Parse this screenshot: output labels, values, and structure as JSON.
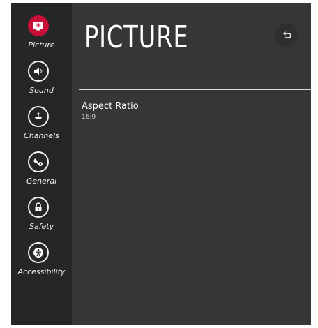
{
  "sidebar": {
    "items": [
      {
        "label": "Picture",
        "icon": "picture-icon",
        "active": true
      },
      {
        "label": "Sound",
        "icon": "sound-icon"
      },
      {
        "label": "Channels",
        "icon": "channels-icon"
      },
      {
        "label": "General",
        "icon": "general-icon"
      },
      {
        "label": "Safety",
        "icon": "lock-icon"
      },
      {
        "label": "Accessibility",
        "icon": "accessibility-icon"
      }
    ]
  },
  "header": {
    "title": "PICTURE",
    "back_icon": "back-arrow-icon"
  },
  "settings": {
    "aspect_ratio": {
      "label": "Aspect Ratio",
      "value": "16:9"
    }
  },
  "colors": {
    "accent": "#c70f3a",
    "background": "#363636",
    "sidebar": "#262626"
  }
}
